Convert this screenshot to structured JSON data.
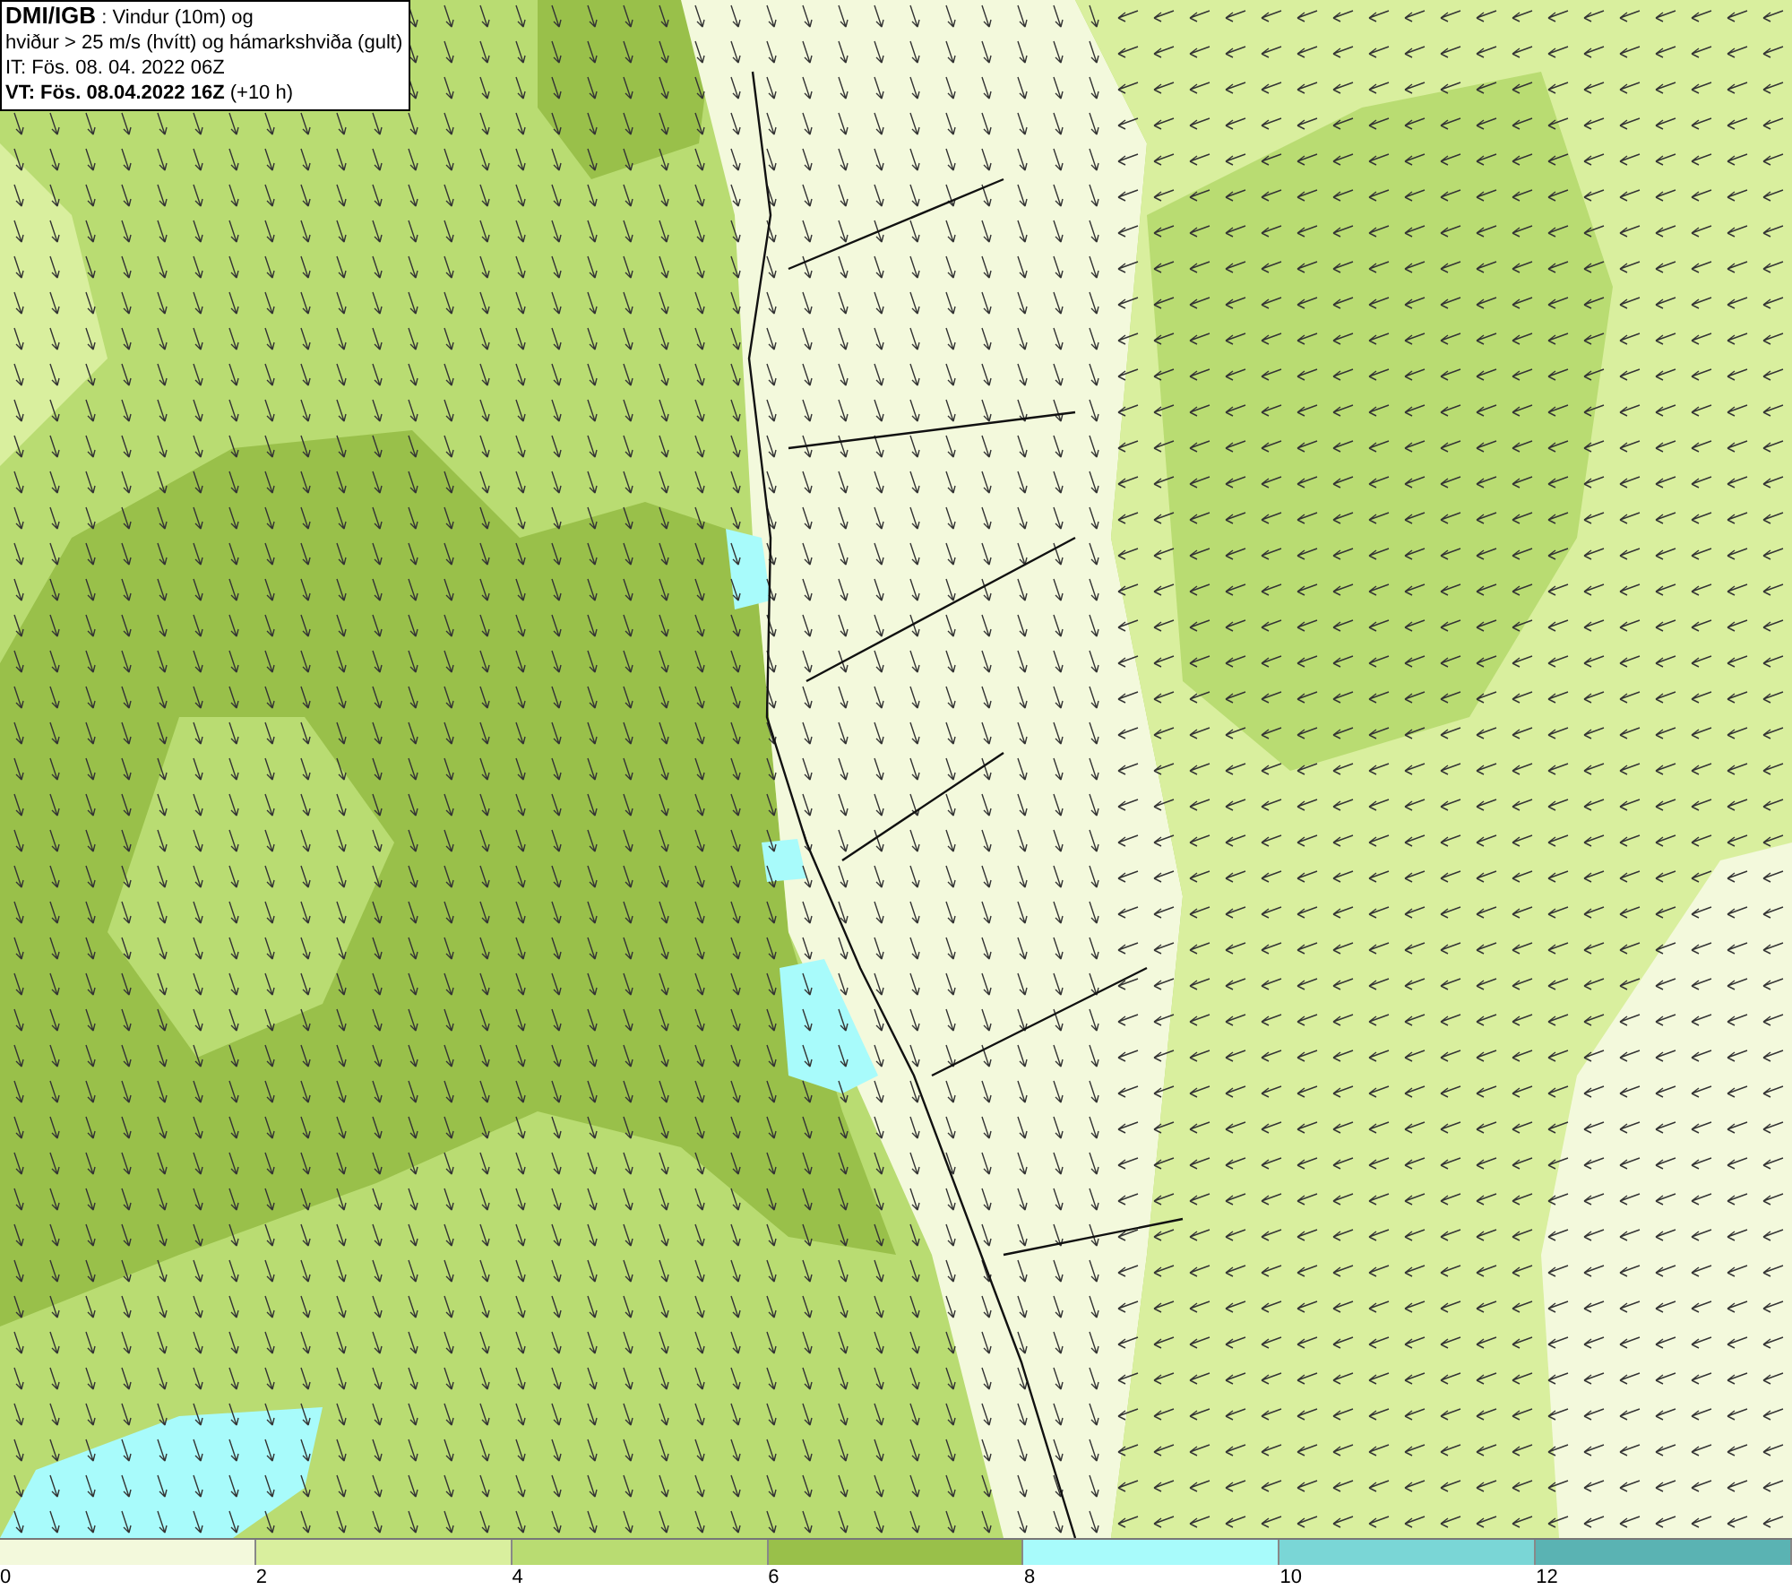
{
  "title_box": {
    "lines": [
      "**DMI/IGB** : Vindur (10m) og",
      "hviður > 25 m/s (hvítt) og hámarkshviða (gult)",
      "IT: Fös. 08. 04. 2022 06Z",
      "**VT: Fös. 08.04.2022 16Z** (+10 h)"
    ]
  },
  "legend": [
    {
      "label": "0",
      "color": "#f3f9dc"
    },
    {
      "label": "2",
      "color": "#d9ef9e"
    },
    {
      "label": "4",
      "color": "#b9dc72"
    },
    {
      "label": "6",
      "color": "#99c04a"
    },
    {
      "label": "8",
      "color": "#a8fbfb"
    },
    {
      "label": "10",
      "color": "#7ad6d6"
    },
    {
      "label": "12",
      "color": "#5ab3b3"
    }
  ]
}
